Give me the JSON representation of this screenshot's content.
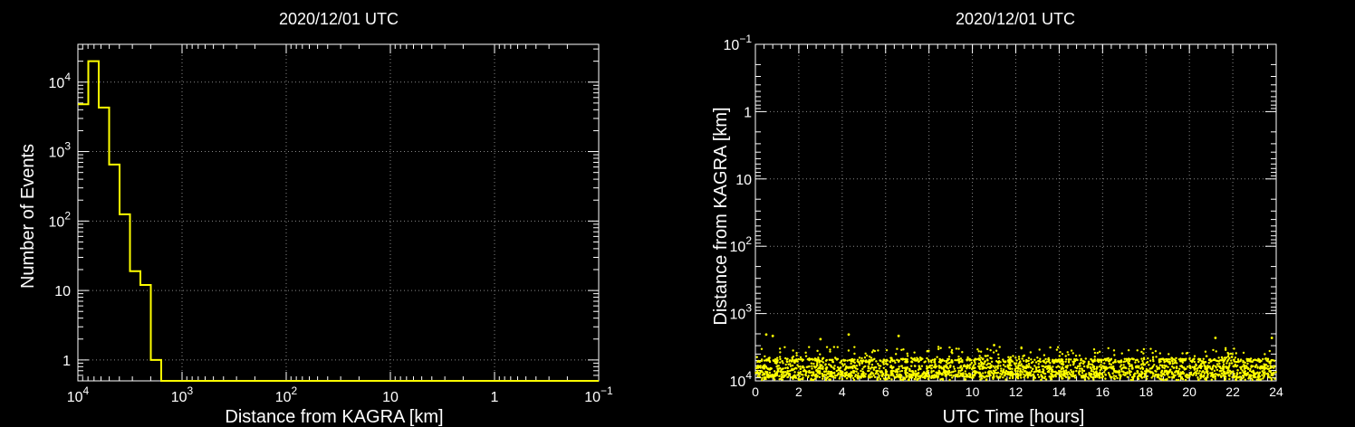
{
  "chart_data": [
    {
      "type": "histogram",
      "title": "2020/12/01 UTC",
      "xlabel": "Distance from KAGRA [km]",
      "ylabel": "Number of Events",
      "x_scale": "log",
      "x_reversed": true,
      "y_scale": "log",
      "xlim": [
        10000,
        0.1
      ],
      "ylim": [
        0.5,
        35000
      ],
      "grid": true,
      "line_color": "#ffff00",
      "x_ticks": [
        {
          "base": "10",
          "exp": "4",
          "value": 10000
        },
        {
          "base": "10",
          "exp": "3",
          "value": 1000
        },
        {
          "base": "10",
          "exp": "2",
          "value": 100
        },
        {
          "base": "10",
          "exp": "",
          "value": 10
        },
        {
          "base": "1",
          "exp": "",
          "value": 1
        },
        {
          "base": "10",
          "exp": "−1",
          "value": 0.1
        }
      ],
      "y_ticks": [
        {
          "base": "1",
          "exp": "",
          "value": 1
        },
        {
          "base": "10",
          "exp": "",
          "value": 10
        },
        {
          "base": "10",
          "exp": "2",
          "value": 100
        },
        {
          "base": "10",
          "exp": "3",
          "value": 1000
        },
        {
          "base": "10",
          "exp": "4",
          "value": 10000
        }
      ],
      "bins": [
        {
          "x_from": 10000,
          "x_to": 7943,
          "count": 4800
        },
        {
          "x_from": 7943,
          "x_to": 6310,
          "count": 20000
        },
        {
          "x_from": 6310,
          "x_to": 5012,
          "count": 4300
        },
        {
          "x_from": 5012,
          "x_to": 3981,
          "count": 650
        },
        {
          "x_from": 3981,
          "x_to": 3162,
          "count": 125
        },
        {
          "x_from": 3162,
          "x_to": 2512,
          "count": 19
        },
        {
          "x_from": 2512,
          "x_to": 1995,
          "count": 12
        },
        {
          "x_from": 1995,
          "x_to": 1585,
          "count": 1
        },
        {
          "x_from": 1585,
          "x_to": 0.1,
          "count": 0
        }
      ]
    },
    {
      "type": "scatter",
      "title": "2020/12/01 UTC",
      "xlabel": "UTC Time [hours]",
      "ylabel": "Distance from KAGRA [km]",
      "x_scale": "linear",
      "y_scale": "log",
      "y_reversed": true,
      "xlim": [
        0,
        24
      ],
      "ylim": [
        0.1,
        10000
      ],
      "grid": true,
      "marker_color": "#ffff00",
      "x_ticks": [
        "0",
        "2",
        "4",
        "6",
        "8",
        "10",
        "12",
        "14",
        "16",
        "18",
        "20",
        "22",
        "24"
      ],
      "y_ticks": [
        {
          "base": "10",
          "exp": "−1",
          "value": 0.1
        },
        {
          "base": "1",
          "exp": "",
          "value": 1
        },
        {
          "base": "10",
          "exp": "",
          "value": 10
        },
        {
          "base": "10",
          "exp": "2",
          "value": 100
        },
        {
          "base": "10",
          "exp": "3",
          "value": 1000
        },
        {
          "base": "10",
          "exp": "4",
          "value": 10000
        }
      ],
      "distribution": {
        "x_range": [
          0,
          24
        ],
        "core_distance_range": [
          4500,
          9800
        ],
        "band_distances": [
          5000,
          6300,
          7500,
          8500
        ],
        "outlier_distance_range": [
          2000,
          4500
        ]
      },
      "notable_points": [
        {
          "x": 0.5,
          "y": 2050
        },
        {
          "x": 0.8,
          "y": 2150
        },
        {
          "x": 3.0,
          "y": 2400
        },
        {
          "x": 4.3,
          "y": 2050
        },
        {
          "x": 6.6,
          "y": 2150
        },
        {
          "x": 11.0,
          "y": 2950
        },
        {
          "x": 21.2,
          "y": 2300
        },
        {
          "x": 23.8,
          "y": 2300
        }
      ]
    }
  ]
}
